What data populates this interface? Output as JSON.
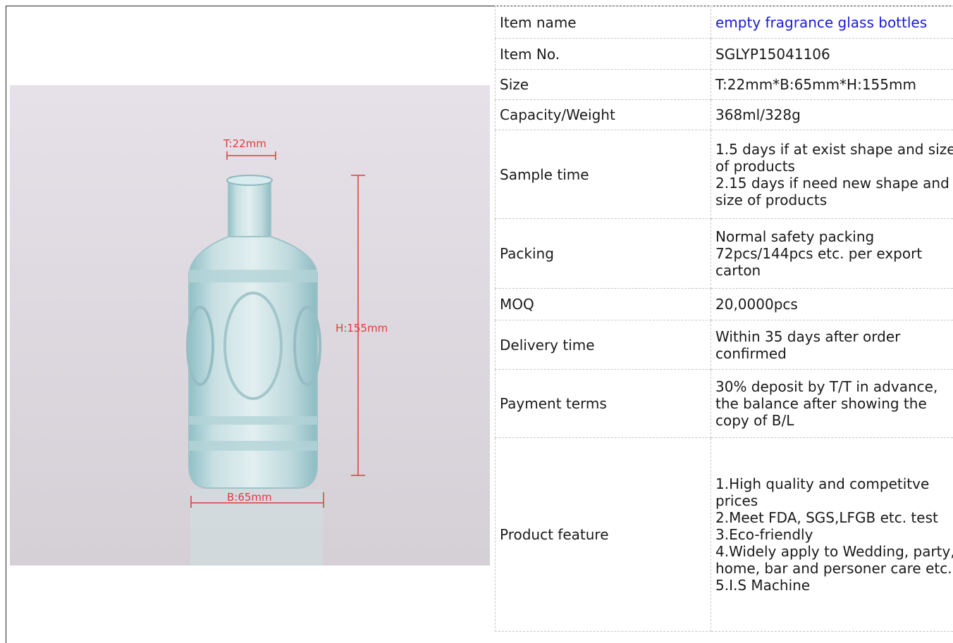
{
  "image": {
    "annotations": {
      "top": "T:22mm",
      "height": "H:155mm",
      "bottom": "B:65mm"
    },
    "colors": {
      "dimension_line": "#e23b3b",
      "glass": "#bcd8dc",
      "background": "#ddd8de"
    }
  },
  "rows": [
    {
      "label": "Item name",
      "value": "empty fragrance glass bottles",
      "link": true
    },
    {
      "label": "Item No.",
      "value": "SGLYP15041106"
    },
    {
      "label": "Size",
      "value": "T:22mm*B:65mm*H:155mm"
    },
    {
      "label": "Capacity/Weight",
      "value": "368ml/328g"
    },
    {
      "label": "Sample time",
      "lines": [
        "1.5 days if at exist shape and size of products",
        "2.15 days if need new shape and size of products"
      ]
    },
    {
      "label": "Packing",
      "lines": [
        "Normal safety packing 72pcs/144pcs etc. per export carton"
      ]
    },
    {
      "label": "MOQ",
      "value": "20,0000pcs"
    },
    {
      "label": "Delivery time",
      "lines": [
        "Within 35 days after order confirmed"
      ]
    },
    {
      "label": "Payment terms",
      "lines": [
        "30% deposit by T/T in advance, the balance after showing the copy of B/L"
      ]
    },
    {
      "label": "Product feature",
      "lines": [
        "1.High quality and competitve prices",
        "2.Meet FDA, SGS,LFGB etc. test",
        "3.Eco-friendly",
        "4.Widely apply to Wedding, party, home, bar and personer care etc.",
        "5.I.S Machine"
      ]
    }
  ]
}
